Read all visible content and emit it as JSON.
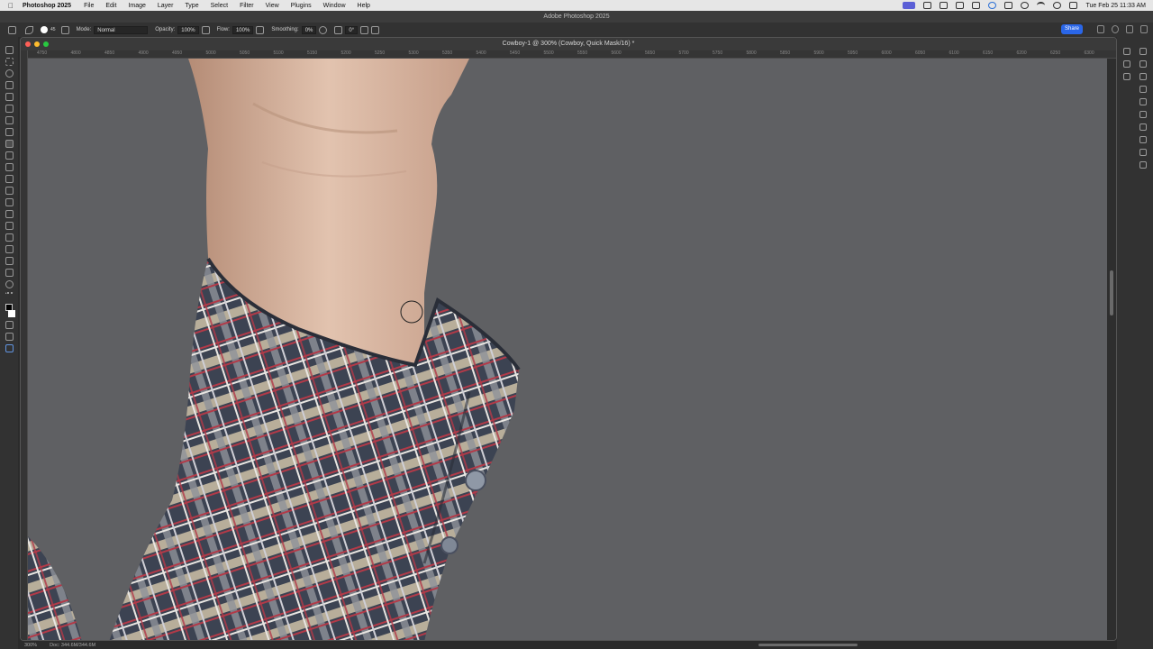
{
  "menubar": {
    "app_name": "Photoshop 2025",
    "items": [
      "File",
      "Edit",
      "Image",
      "Layer",
      "Type",
      "Select",
      "Filter",
      "View",
      "Plugins",
      "Window",
      "Help"
    ],
    "clock": "Tue Feb 25  11:33 AM"
  },
  "window_title": "Adobe Photoshop 2025",
  "options": {
    "brush_size": "45",
    "mode_label": "Mode:",
    "mode_value": "Normal",
    "opacity_label": "Opacity:",
    "opacity_value": "100%",
    "flow_label": "Flow:",
    "flow_value": "100%",
    "smoothing_label": "Smoothing:",
    "smoothing_value": "0%",
    "angle_value": "0°",
    "share_label": "Share"
  },
  "document": {
    "title": "Cowboy-1 @ 300% (Cowboy, Quick Mask/16) *",
    "ruler_labels": [
      "4750",
      "4800",
      "4850",
      "4900",
      "4950",
      "5000",
      "5050",
      "5100",
      "5150",
      "5200",
      "5250",
      "5300",
      "5350",
      "5400",
      "5450",
      "5500",
      "5550",
      "5600",
      "5650",
      "5700",
      "5750",
      "5800",
      "5850",
      "5900",
      "5950",
      "6000",
      "6050",
      "6100",
      "6150",
      "6200",
      "6250",
      "6300"
    ]
  },
  "status": {
    "zoom": "300%",
    "doc_size": "Doc: 344.6M/344.6M"
  },
  "colors": {
    "background": "#5f6063",
    "skin": "#d9b7a2",
    "plaid_dark": "#3a4250",
    "plaid_red": "#b23a48",
    "plaid_beige": "#b5ab97"
  }
}
